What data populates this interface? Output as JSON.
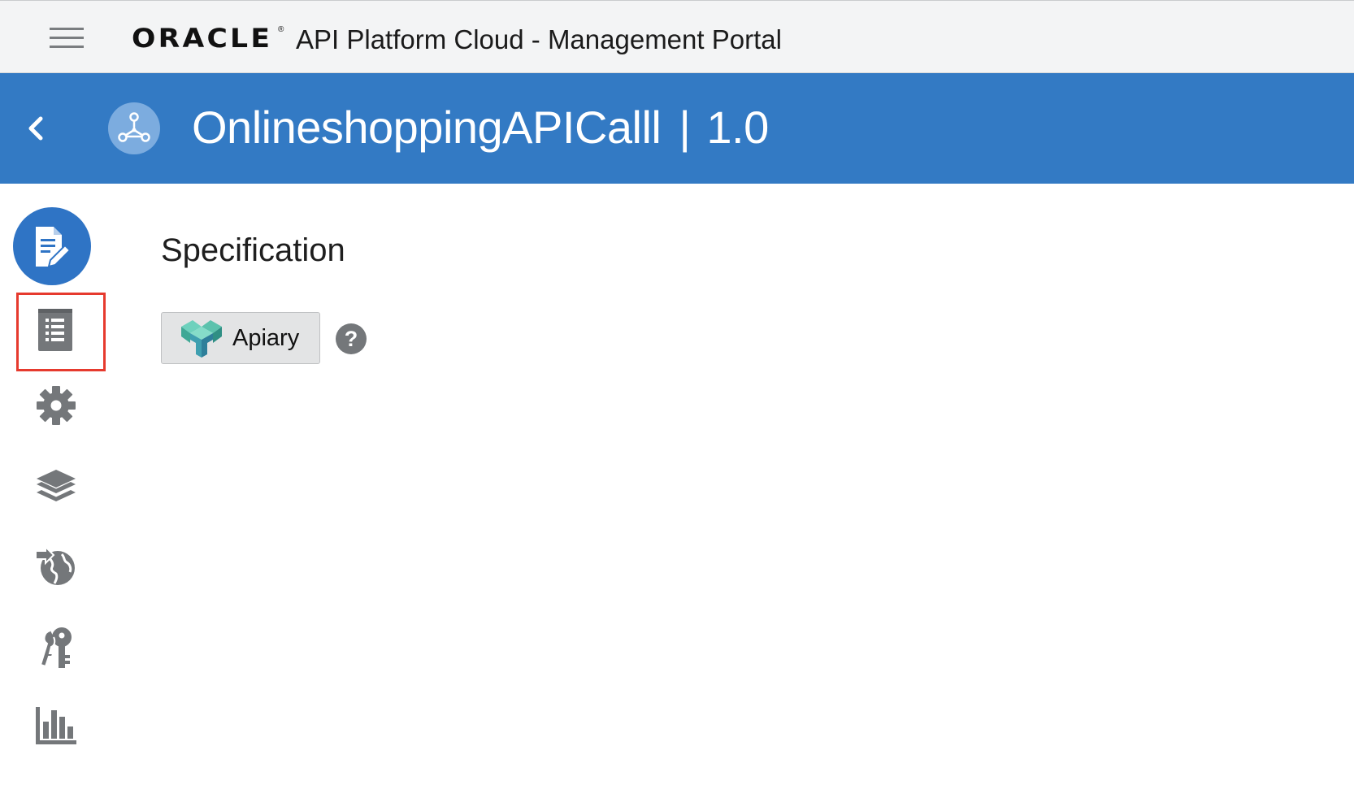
{
  "top_bar": {
    "brand": "ORACLE",
    "brand_mark": "®",
    "title": "API Platform Cloud - Management Portal"
  },
  "api_header": {
    "api_name": "OnlineshoppingAPICalll",
    "separator": "|",
    "version": "1.0"
  },
  "sidebar": {
    "items": [
      {
        "icon": "document-edit-icon",
        "active": true
      },
      {
        "icon": "clipboard-list-icon",
        "highlighted": true
      },
      {
        "icon": "gear-icon"
      },
      {
        "icon": "layers-icon"
      },
      {
        "icon": "globe-deploy-icon"
      },
      {
        "icon": "keys-icon"
      },
      {
        "icon": "bar-chart-icon"
      }
    ]
  },
  "main": {
    "section_title": "Specification",
    "apiary_button_label": "Apiary",
    "help_label": "?"
  },
  "colors": {
    "header_blue": "#337ac4",
    "active_circle": "#2f74c5",
    "icon_gray": "#74777a",
    "highlight_red": "#e63a2e"
  }
}
